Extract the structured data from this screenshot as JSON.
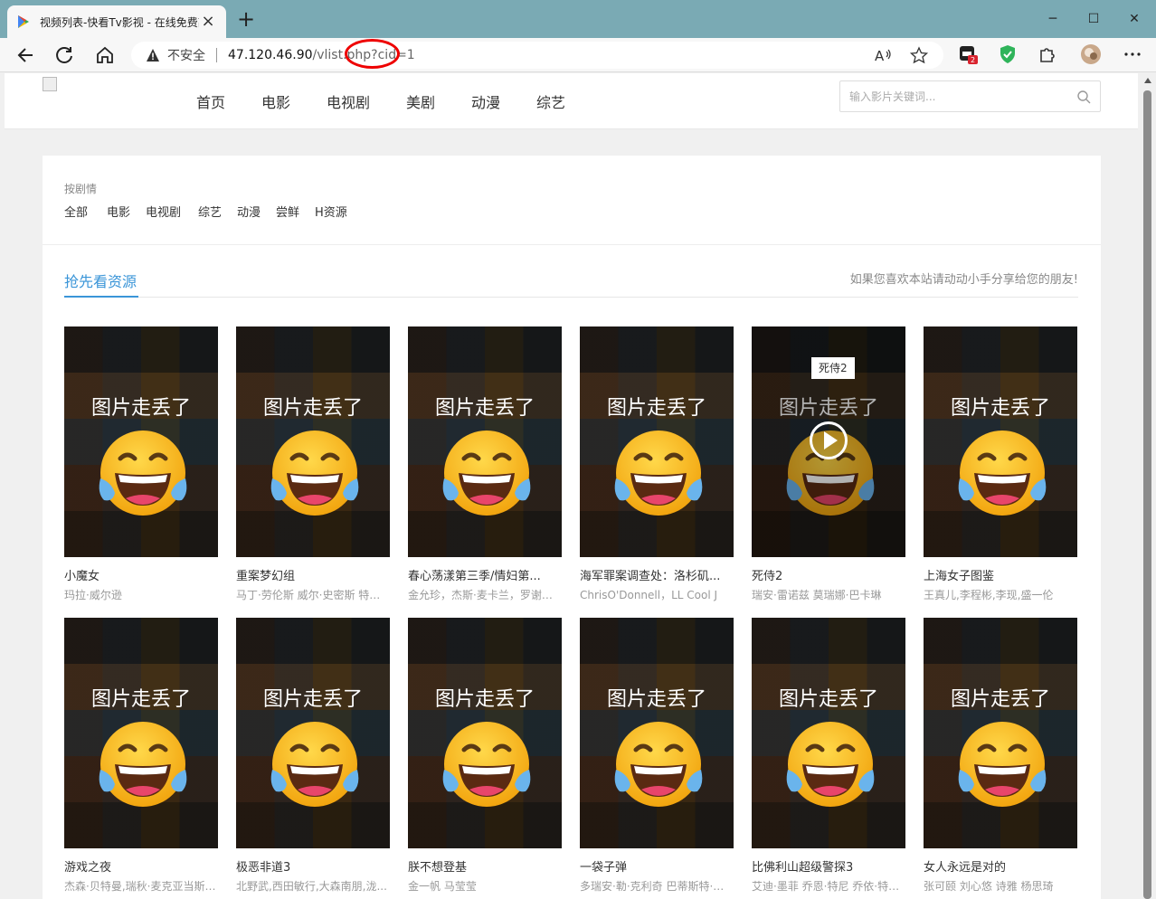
{
  "browser": {
    "tab_title": "视频列表-快看Tv影视 - 在线免费高",
    "tab_close": "×",
    "new_tab": "+",
    "window": {
      "minimize": "─",
      "maximize": "☐",
      "close": "✕"
    },
    "address": {
      "insecure_label": "不安全",
      "host": "47.120.46.90",
      "path": "/vlist.php?cid=1"
    },
    "extension_badge": "2"
  },
  "site": {
    "nav": [
      "首页",
      "电影",
      "电视剧",
      "美剧",
      "动漫",
      "综艺"
    ],
    "search_placeholder": "输入影片关键词..."
  },
  "filter": {
    "heading": "按剧情",
    "items": [
      "全部",
      "电影",
      "电视剧",
      "综艺",
      "动漫",
      "尝鲜",
      "H资源"
    ]
  },
  "section": {
    "title": "抢先看资源",
    "note": "如果您喜欢本站请动动小手分享给您的朋友!"
  },
  "thumb_text": "图片走丢了",
  "videos": [
    {
      "title": "小魔女",
      "cast": "玛拉·威尔逊"
    },
    {
      "title": "重案梦幻组",
      "cast": "马丁·劳伦斯 威尔·史密斯 特里..."
    },
    {
      "title": "春心荡漾第三季/情妇第...",
      "cast": "金允珍，杰斯·麦卡兰，罗谢尔..."
    },
    {
      "title": "海军罪案调查处：洛杉矶...",
      "cast": "ChrisO'Donnell，LL Cool J"
    },
    {
      "title": "死侍2",
      "cast": "瑞安·雷诺兹 莫瑞娜·巴卡琳",
      "hover_tag": "死侍2"
    },
    {
      "title": "上海女子图鉴",
      "cast": "王真儿,李程彬,李现,盛一伦"
    },
    {
      "title": "游戏之夜",
      "cast": "杰森·贝特曼,瑞秋·麦克亚当斯,..."
    },
    {
      "title": "极恶非道3",
      "cast": "北野武,西田敏行,大森南朋,泷..."
    },
    {
      "title": "朕不想登基",
      "cast": "金一帆 马莹莹"
    },
    {
      "title": "一袋子弹",
      "cast": "多瑞安·勒·克利奇 巴蒂斯特·弗..."
    },
    {
      "title": "比佛利山超级警探3",
      "cast": "艾迪·墨菲 乔恩·特尼 乔依·特拉..."
    },
    {
      "title": "女人永远是对的",
      "cast": "张可颐 刘心悠 诗雅 杨思琦"
    }
  ]
}
